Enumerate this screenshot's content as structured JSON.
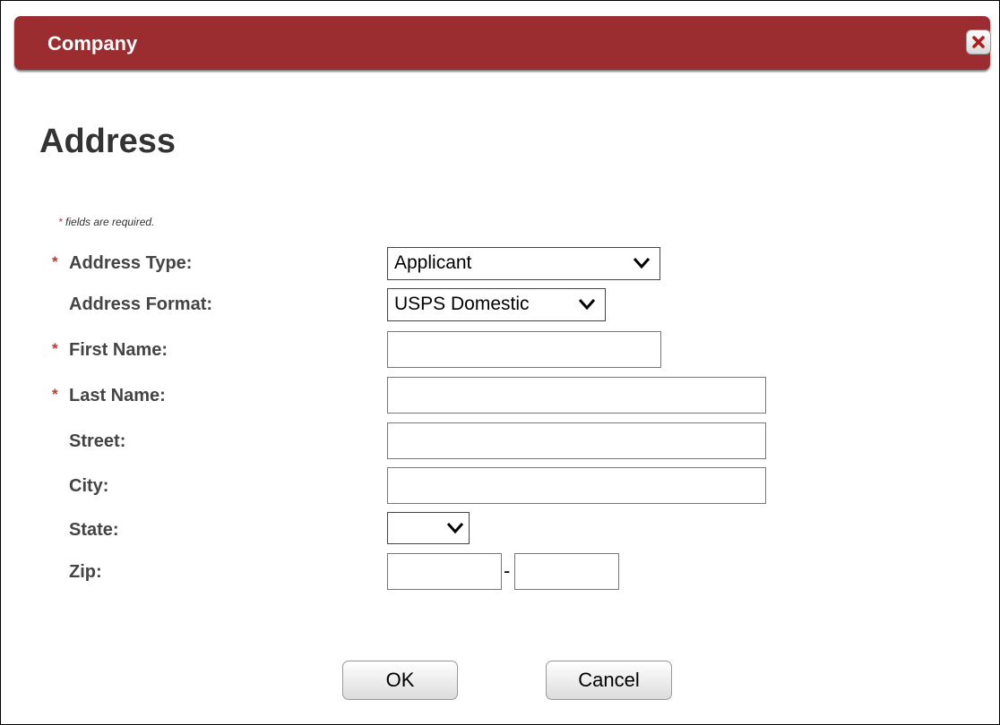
{
  "window": {
    "title": "Company"
  },
  "heading": "Address",
  "required_note": {
    "marker": "*",
    "text": "fields are required."
  },
  "form": {
    "address_type": {
      "label": "Address Type:",
      "required": true,
      "value": "Applicant"
    },
    "address_format": {
      "label": "Address Format:",
      "required": false,
      "value": "USPS Domestic"
    },
    "first_name": {
      "label": "First Name:",
      "required": true,
      "value": ""
    },
    "last_name": {
      "label": "Last Name:",
      "required": true,
      "value": ""
    },
    "street": {
      "label": "Street:",
      "required": false,
      "value": ""
    },
    "city": {
      "label": "City:",
      "required": false,
      "value": ""
    },
    "state": {
      "label": "State:",
      "required": false,
      "value": ""
    },
    "zip": {
      "label": "Zip:",
      "required": false,
      "value": "",
      "ext_value": "",
      "separator": "-"
    }
  },
  "buttons": {
    "ok": "OK",
    "cancel": "Cancel"
  },
  "colors": {
    "titlebar": "#9b2c2f",
    "required_star": "#c0392b"
  },
  "icons": {
    "close": "close-x-icon",
    "dropdown": "chevron-down-icon"
  }
}
